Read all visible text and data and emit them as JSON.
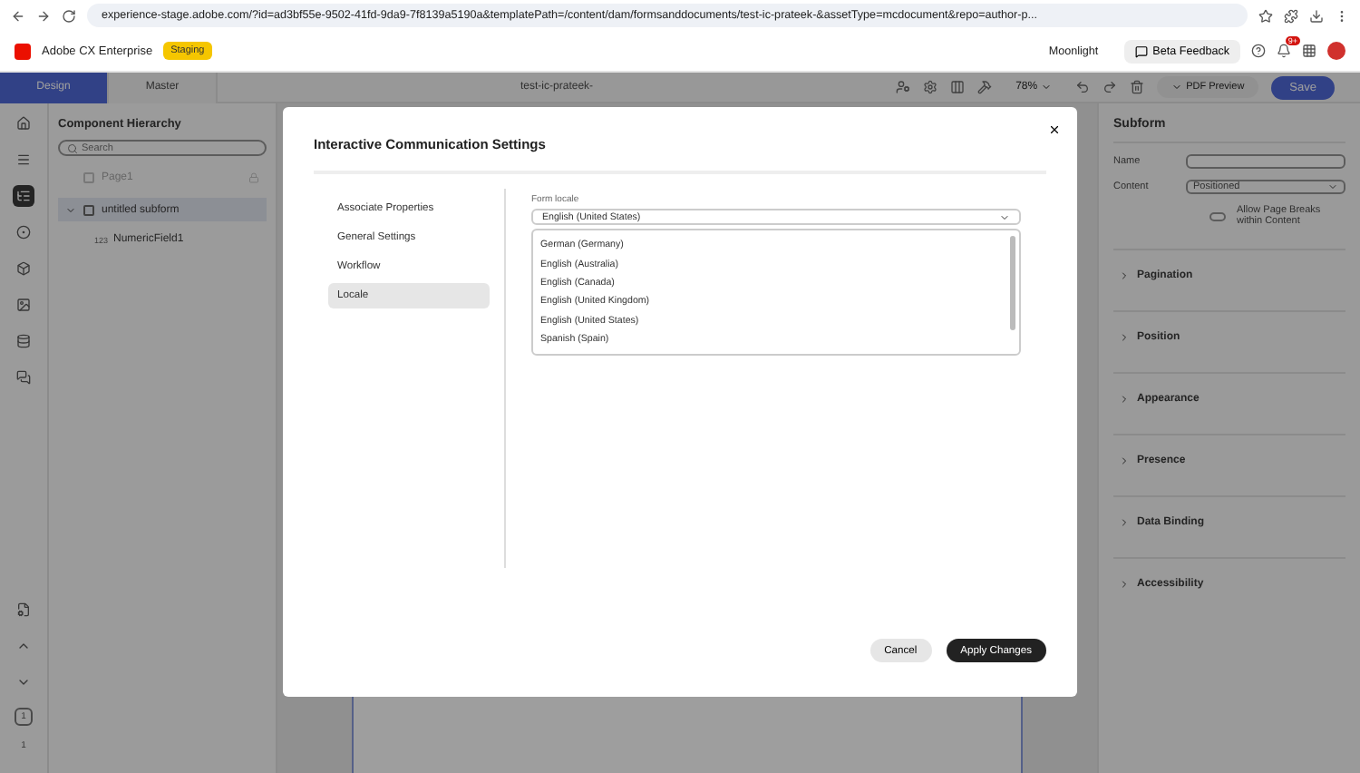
{
  "browser": {
    "url": "experience-stage.adobe.com/?id=ad3bf55e-9502-41fd-9da9-7f8139a5190a&templatePath=/content/dam/formsanddocuments/test-ic-prateek-&assetType=mcdocument&repo=author-p..."
  },
  "header": {
    "product": "Adobe CX Enterprise",
    "badge": "Staging",
    "user": "Moonlight",
    "feedback": "Beta Feedback",
    "notifications": "9+"
  },
  "toolbar": {
    "tabs": [
      {
        "label": "Design",
        "selected": true
      },
      {
        "label": "Master",
        "selected": false
      }
    ],
    "document_title": "test-ic-prateek-",
    "zoom": "78%",
    "pdf_preview": "PDF Preview",
    "save": "Save"
  },
  "hierarchy": {
    "title": "Component Hierarchy",
    "search_placeholder": "Search",
    "items": [
      {
        "label": "Page1",
        "disabled": true,
        "selected": false
      },
      {
        "label": "untitled subform",
        "disabled": false,
        "selected": true,
        "expanded": true,
        "children": [
          {
            "label": "NumericField1",
            "type_label": "123"
          }
        ]
      }
    ]
  },
  "rail": {
    "page_number": "1",
    "page_count": "1"
  },
  "properties": {
    "title": "Subform",
    "name_label": "Name",
    "content_label": "Content",
    "content_value": "Positioned",
    "toggle": {
      "label": "Allow Page Breaks within Content",
      "on": false
    },
    "sections": [
      "Pagination",
      "Position",
      "Appearance",
      "Presence",
      "Data Binding",
      "Accessibility"
    ]
  },
  "modal": {
    "title": "Interactive Communication Settings",
    "nav": [
      {
        "label": "Associate Properties",
        "selected": false
      },
      {
        "label": "General Settings",
        "selected": false
      },
      {
        "label": "Workflow",
        "selected": false
      },
      {
        "label": "Locale",
        "selected": true
      }
    ],
    "field_label": "Form locale",
    "value": "English (United States)",
    "options": [
      "German (Germany)",
      "English (Australia)",
      "English (Canada)",
      "English (United Kingdom)",
      "English (United States)",
      "Spanish (Spain)"
    ],
    "cancel": "Cancel",
    "apply": "Apply Changes"
  }
}
